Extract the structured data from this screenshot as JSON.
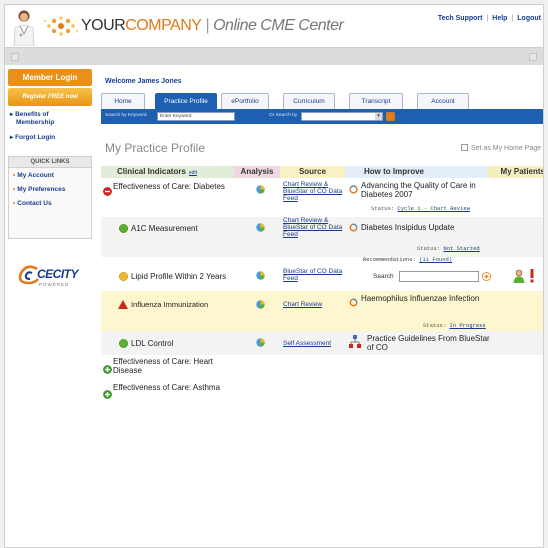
{
  "header": {
    "brand_you": "YOUR",
    "brand_company": "COMPANY",
    "brand_separator": "|",
    "brand_sub": "Online CME Center",
    "links": [
      "Tech Support",
      "Help",
      "Logout"
    ],
    "link_separator": "|"
  },
  "left": {
    "member_login": "Member Login",
    "register": "Register FREE now",
    "benefits": [
      "Benefits of",
      "Membership"
    ],
    "forgot": "Forgot Login",
    "quick_links_title": "QUICK LINKS",
    "quick_links": [
      "My Account",
      "My Preferences",
      "Contact Us"
    ],
    "logo_text": "CECITY",
    "logo_powered": "POWERED"
  },
  "main": {
    "welcome": "Welcome James Jones",
    "tabs": [
      "Home",
      "Practice Profile",
      "ePortfolio",
      "Curriculum",
      "Transcript",
      "Account"
    ],
    "active_tab": "Practice Profile",
    "search_keyword_label": "Search by Keyword",
    "search_keyword_value": "Enter Keyword",
    "search_or_label": "Or Search by",
    "page_title": "My Practice Profile",
    "set_home": "Set as My Home Page"
  },
  "table": {
    "headers": {
      "clinical_indicators": "Clinical Indicators",
      "edit": "edit",
      "analysis": "Analysis",
      "source": "Source",
      "how_to_improve": "How to Improve",
      "my_patients": "My Patients"
    },
    "rows": [
      {
        "indicator": "Effectiveness of Care: Diabetes",
        "icon": "minus-circle-icon"
      },
      {
        "indicator": "A1C Measurement",
        "source": "Chart Review & BlueStar of CO Data Feed",
        "improve": "Diabetes Insipidus Update",
        "status_label": "Status:",
        "status": "Not Started"
      },
      {
        "indicator": "Lipid Profile Within 2 Years",
        "source": "BlueStar of CO Data Feed"
      },
      {
        "indicator": "Influenza Immunization",
        "source": "Chart Review",
        "improve": "Haemophilus Influenzae Infection",
        "status_label": "Status:",
        "status": "In Progress"
      },
      {
        "indicator": "LDL Control",
        "source": "Self Assessment",
        "improve": "Practice Guidelines From BlueStar of CO"
      },
      {
        "indicator": "Effectiveness of Care: Heart Disease",
        "icon": "plus-circle-icon"
      },
      {
        "indicator": "Effectiveness of Care: Asthma",
        "icon": "plus-circle-icon"
      }
    ],
    "diabetes_source": "Chart Review & BlueStar of CO Data Feed",
    "diabetes_improve": "Advancing the Quality of Care in Diabetes 2007",
    "diabetes_status_label": "Status:",
    "diabetes_status": "Cycle 1 - Chart Review",
    "recommendations_label": "Recommendations:",
    "recommendations_count": "(11 Found)",
    "search_label": "Search"
  },
  "colors": {
    "brand_blue": "#1d5fb0",
    "accent_orange": "#e07a1a",
    "status_green": "#5cb030",
    "status_yellow": "#f0b828",
    "status_red": "#c8281e",
    "highlight_row": "#fdf6cf"
  }
}
